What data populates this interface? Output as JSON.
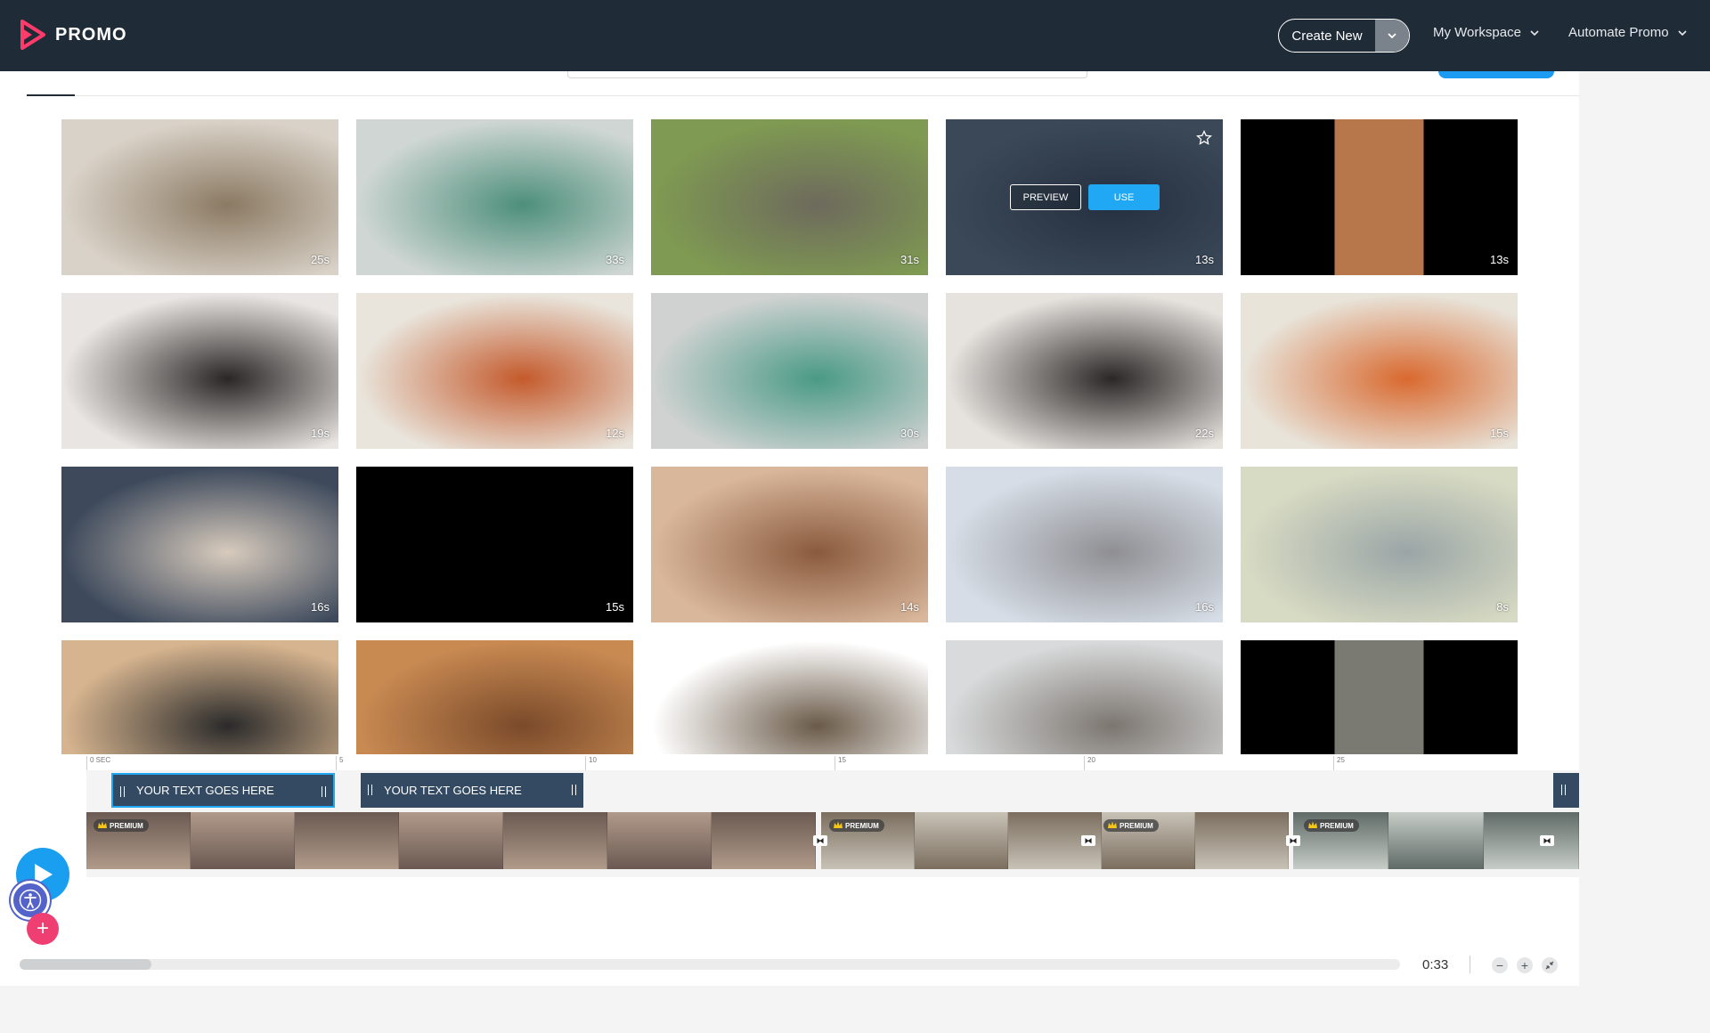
{
  "header": {
    "logo_text": "PROMO",
    "create_new": "Create New",
    "nav": [
      {
        "label": "My Workspace"
      },
      {
        "label": "Automate Promo"
      }
    ]
  },
  "colors": {
    "accent": "#21a8f5",
    "nav_bg": "#202b38",
    "add": "#ef3f72"
  },
  "gallery": {
    "hover_actions": {
      "preview": "PREVIEW",
      "use": "USE"
    },
    "tiles": [
      {
        "duration": "25s",
        "scene": "woman holding tabby cat at vet",
        "c1": "#d9d2c8",
        "c2": "#8b7a63"
      },
      {
        "duration": "33s",
        "scene": "vet nurse examining cat",
        "c1": "#cfd6d4",
        "c2": "#4d8f7a"
      },
      {
        "duration": "31s",
        "scene": "cats outdoors by tree stump",
        "c1": "#7f9a52",
        "c2": "#6d6a5c"
      },
      {
        "duration": "13s",
        "scene": "person with cat on lap",
        "c1": "#50606e",
        "c2": "#2f3c4b",
        "hovered": true
      },
      {
        "duration": "13s",
        "scene": "orange white cat vertical",
        "c1": "#000000",
        "c2": "#b7774a"
      },
      {
        "duration": "19s",
        "scene": "black cat on wooden deck",
        "c1": "#e8e5e2",
        "c2": "#2a2625"
      },
      {
        "duration": "12s",
        "scene": "woman with cat by plants",
        "c1": "#e9e5dc",
        "c2": "#c45a2c"
      },
      {
        "duration": "30s",
        "scene": "vet with fluffy cat",
        "c1": "#cfd2d1",
        "c2": "#4a9a86"
      },
      {
        "duration": "22s",
        "scene": "two black cats on deck",
        "c1": "#e6e2de",
        "c2": "#2b2726"
      },
      {
        "duration": "15s",
        "scene": "woman holding tabby",
        "c1": "#e8e4da",
        "c2": "#d9692f"
      },
      {
        "duration": "16s",
        "scene": "cat with laptop on sofa",
        "c1": "#3e4a5c",
        "c2": "#d8cbbd"
      },
      {
        "duration": "15s",
        "scene": "black frame",
        "c1": "#000000",
        "c2": "#000000"
      },
      {
        "duration": "14s",
        "scene": "woman hugging cat",
        "c1": "#d9b79b",
        "c2": "#8a5a3e"
      },
      {
        "duration": "16s",
        "scene": "kitten lying down",
        "c1": "#d6dde6",
        "c2": "#8f8f93"
      },
      {
        "duration": "8s",
        "scene": "fluffy white cat",
        "c1": "#d8dbc3",
        "c2": "#9aa5a6"
      },
      {
        "duration": "",
        "scene": "cat on desk keyboard",
        "c1": "#d6b48f",
        "c2": "#2a2a2a"
      },
      {
        "duration": "",
        "scene": "ginger cat portrait",
        "c1": "#c98a52",
        "c2": "#7a4a2a"
      },
      {
        "duration": "",
        "scene": "cats on white",
        "c1": "#ffffff",
        "c2": "#6a5a48"
      },
      {
        "duration": "",
        "scene": "person petting cat",
        "c1": "#d8dadb",
        "c2": "#7c7670"
      },
      {
        "duration": "",
        "scene": "cat in doorway",
        "c1": "#000000",
        "c2": "#7a7a72"
      }
    ]
  },
  "timeline": {
    "ruler": [
      "0 SEC",
      "5",
      "10",
      "15",
      "20",
      "25"
    ],
    "text_clips": [
      {
        "label": "YOUR TEXT GOES HERE"
      },
      {
        "label": "YOUR TEXT GOES HERE"
      }
    ],
    "premium_label": "PREMIUM",
    "total_time": "0:33",
    "zoom_out": "−",
    "zoom_in": "+"
  }
}
